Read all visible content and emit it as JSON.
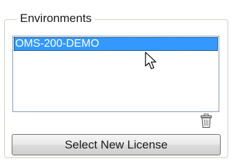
{
  "group": {
    "title": "Environments"
  },
  "environments": {
    "items": [
      "OMS-200-DEMO"
    ],
    "selected_index": 0
  },
  "actions": {
    "delete_icon": "trash-icon",
    "select_license_label": "Select New License"
  },
  "colors": {
    "selection_bg": "#3399ff",
    "selection_text": "#ffffff",
    "list_border": "#7f9db9",
    "group_border": "#d0d0bf"
  },
  "icons": {
    "cursor": "mouse-pointer-icon"
  }
}
